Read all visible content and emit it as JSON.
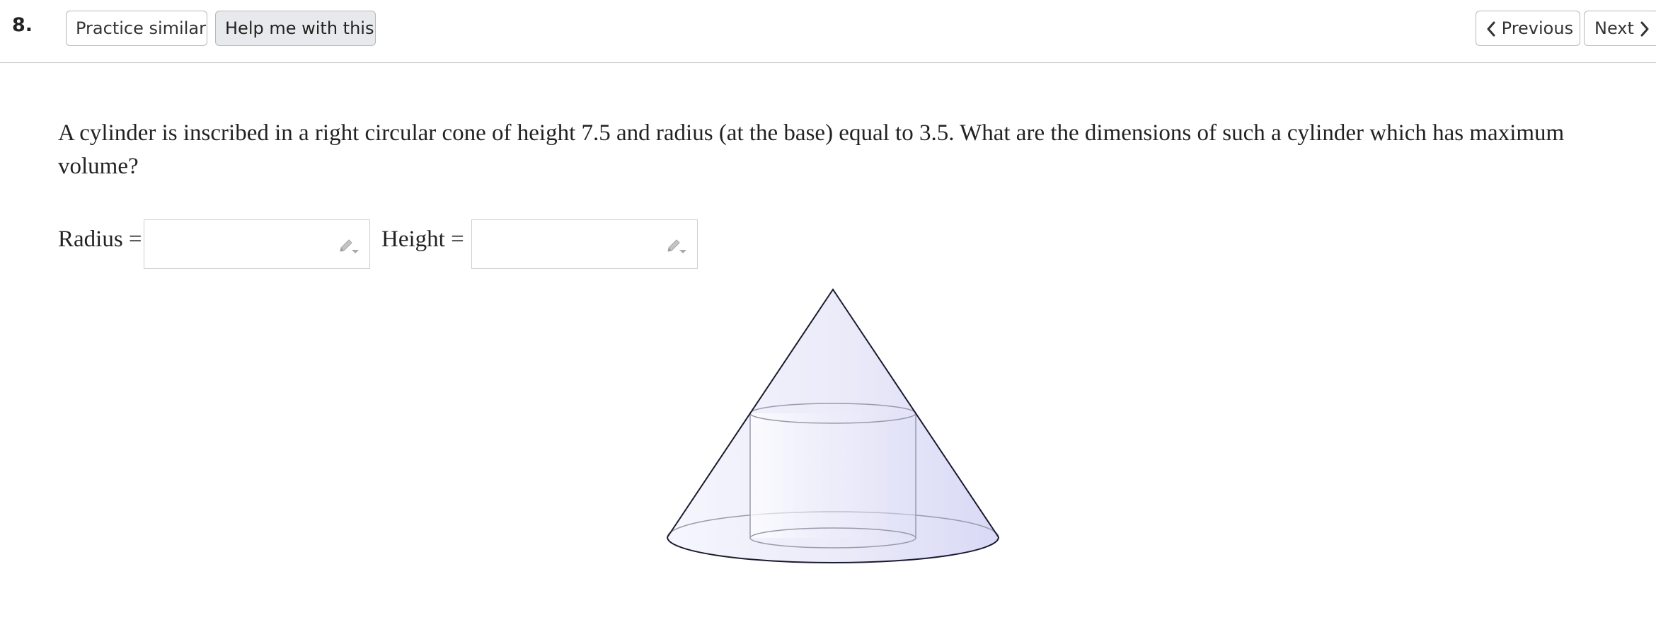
{
  "header": {
    "question_number": "8.",
    "practice_label": "Practice similar",
    "help_label": "Help me with this",
    "previous_label": "Previous",
    "next_label": "Next"
  },
  "question": {
    "text": "A cylinder is inscribed in a right circular cone of height 7.5 and radius (at the base) equal to 3.5. What are the dimensions of such a cylinder which has maximum volume?"
  },
  "answers": {
    "radius_label": "Radius =",
    "radius_value": "",
    "height_label": "Height =",
    "height_value": ""
  },
  "icons": {
    "edit": "pencil-dropdown-icon",
    "previous": "chevron-left-icon",
    "next": "chevron-right-icon"
  },
  "colors": {
    "cone_fill": "#e4e4fa",
    "cone_stroke": "#1a1a2e",
    "cylinder_stroke": "#9a9aaa"
  }
}
